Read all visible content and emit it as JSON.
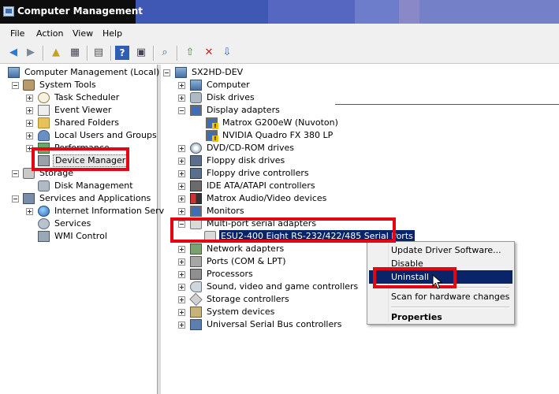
{
  "window": {
    "title": "Computer Management"
  },
  "menu": [
    "File",
    "Action",
    "View",
    "Help"
  ],
  "left_tree": [
    {
      "label": "Computer Management (Local)",
      "icon": "computer-management-icon"
    },
    {
      "label": "System Tools",
      "icon": "system-tools-icon"
    },
    {
      "label": "Task Scheduler",
      "icon": "task-scheduler-icon"
    },
    {
      "label": "Event Viewer",
      "icon": "event-viewer-icon"
    },
    {
      "label": "Shared Folders",
      "icon": "shared-folders-icon"
    },
    {
      "label": "Local Users and Groups",
      "icon": "users-icon"
    },
    {
      "label": "Performance",
      "icon": "performance-icon"
    },
    {
      "label": "Device Manager",
      "icon": "device-manager-icon"
    },
    {
      "label": "Storage",
      "icon": "storage-icon"
    },
    {
      "label": "Disk Management",
      "icon": "disk-management-icon"
    },
    {
      "label": "Services and Applications",
      "icon": "services-applications-icon"
    },
    {
      "label": "Internet Information Serv",
      "icon": "iis-globe-icon"
    },
    {
      "label": "Services",
      "icon": "services-gear-icon"
    },
    {
      "label": "WMI Control",
      "icon": "wmi-control-icon"
    }
  ],
  "device_tree": [
    {
      "label": "SX2HD-DEV",
      "icon": "computer-icon"
    },
    {
      "label": "Computer",
      "icon": "computer-icon"
    },
    {
      "label": "Disk drives",
      "icon": "disk-drive-icon"
    },
    {
      "label": "Display adapters",
      "icon": "display-adapter-icon"
    },
    {
      "label": "Matrox G200eW (Nuvoton)",
      "icon": "display-warning-icon"
    },
    {
      "label": "NVIDIA Quadro FX 380 LP",
      "icon": "display-warning-icon"
    },
    {
      "label": "DVD/CD-ROM drives",
      "icon": "dvd-drive-icon"
    },
    {
      "label": "Floppy disk drives",
      "icon": "floppy-icon"
    },
    {
      "label": "Floppy drive controllers",
      "icon": "floppy-controller-icon"
    },
    {
      "label": "IDE ATA/ATAPI controllers",
      "icon": "ide-controller-icon"
    },
    {
      "label": "Matrox Audio/Video devices",
      "icon": "audio-video-icon"
    },
    {
      "label": "Monitors",
      "icon": "monitor-icon"
    },
    {
      "label": "Multi-port serial adapters",
      "icon": "serial-adapter-icon"
    },
    {
      "label": "ESU2-400 Eight RS-232/422/485 Serial Ports",
      "icon": "serial-port-icon"
    },
    {
      "label": "Network adapters",
      "icon": "network-adapter-icon"
    },
    {
      "label": "Ports (COM & LPT)",
      "icon": "ports-icon"
    },
    {
      "label": "Processors",
      "icon": "processor-icon"
    },
    {
      "label": "Sound, video and game controllers",
      "icon": "sound-icon"
    },
    {
      "label": "Storage controllers",
      "icon": "storage-controller-icon"
    },
    {
      "label": "System devices",
      "icon": "system-devices-icon"
    },
    {
      "label": "Universal Serial Bus controllers",
      "icon": "usb-icon"
    }
  ],
  "context_menu": {
    "items": [
      "Update Driver Software...",
      "Disable",
      "Uninstall",
      "Scan for hardware changes",
      "Properties"
    ],
    "highlighted": "Uninstall"
  },
  "colors": {
    "highlight_box": "#e30613",
    "selection": "#0a246a"
  }
}
